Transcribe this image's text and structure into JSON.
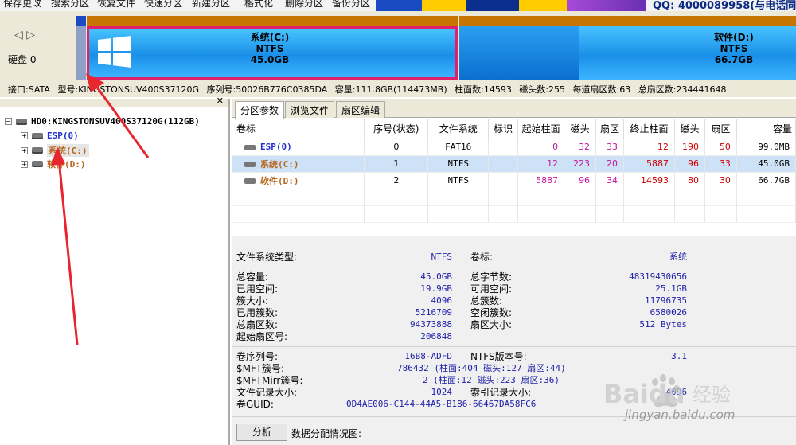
{
  "toolbar": {
    "items": [
      "保存更改",
      "搜索分区",
      "恢复文件",
      "快速分区",
      "新建分区",
      "格式化",
      "删除分区",
      "备份分区"
    ],
    "banner_text": "QQ: 4000089958(与电话同号"
  },
  "disk_strip": {
    "nav_arrows": "◁ ▷",
    "disk_label": "硬盘 0",
    "partitions": [
      {
        "name": "系统(C:)",
        "fs": "NTFS",
        "size": "45.0GB"
      },
      {
        "name": "软件(D:)",
        "fs": "NTFS",
        "size": "66.7GB"
      }
    ]
  },
  "disk_info": {
    "interface": "接口:SATA",
    "model": "型号:KINGSTONSUV400S37120G",
    "serial": "序列号:50026B776C0385DA",
    "capacity": "容量:111.8GB(114473MB)",
    "cylinders": "柱面数:14593",
    "heads": "磁头数:255",
    "sectors_per_track": "每道扇区数:63",
    "total_sectors": "总扇区数:234441648"
  },
  "tree": {
    "disk": "HD0:KINGSTONSUV400S37120G(112GB)",
    "partitions": [
      "ESP(0)",
      "系统(C:)",
      "软件(D:)"
    ]
  },
  "tabs": [
    "分区参数",
    "浏览文件",
    "扇区编辑"
  ],
  "partition_table": {
    "headers": [
      "卷标",
      "序号(状态)",
      "文件系统",
      "标识",
      "起始柱面",
      "磁头",
      "扇区",
      "终止柱面",
      "磁头",
      "扇区",
      "容量"
    ],
    "rows": [
      {
        "label": "ESP(0)",
        "index": "0",
        "fs": "FAT16",
        "flag": "",
        "start_cyl": "0",
        "start_head": "32",
        "start_sec": "33",
        "end_cyl": "12",
        "end_head": "190",
        "end_sec": "50",
        "size": "99.0MB"
      },
      {
        "label": "系统(C:)",
        "index": "1",
        "fs": "NTFS",
        "flag": "",
        "start_cyl": "12",
        "start_head": "223",
        "start_sec": "20",
        "end_cyl": "5887",
        "end_head": "96",
        "end_sec": "33",
        "size": "45.0GB"
      },
      {
        "label": "软件(D:)",
        "index": "2",
        "fs": "NTFS",
        "flag": "",
        "start_cyl": "5887",
        "start_head": "96",
        "start_sec": "34",
        "end_cyl": "14593",
        "end_head": "80",
        "end_sec": "30",
        "size": "66.7GB"
      }
    ]
  },
  "details": {
    "fs_type_label": "文件系统类型:",
    "fs_type": "NTFS",
    "volume_label_label": "卷标:",
    "volume_label": "系统",
    "total_capacity_label": "总容量:",
    "total_capacity": "45.0GB",
    "total_bytes_label": "总字节数:",
    "total_bytes": "48319430656",
    "used_space_label": "已用空间:",
    "used_space": "19.9GB",
    "free_space_label": "可用空间:",
    "free_space": "25.1GB",
    "cluster_size_label": "簇大小:",
    "cluster_size": "4096",
    "total_clusters_label": "总簇数:",
    "total_clusters": "11796735",
    "used_clusters_label": "已用簇数:",
    "used_clusters": "5216709",
    "free_clusters_label": "空闲簇数:",
    "free_clusters": "6580026",
    "total_sectors_label": "总扇区数:",
    "total_sectors": "94373888",
    "sector_size_label": "扇区大小:",
    "sector_size": "512 Bytes",
    "start_sector_label": "起始扇区号:",
    "start_sector": "206848",
    "volume_serial_label": "卷序列号:",
    "volume_serial": "16B8-ADFD",
    "ntfs_version_label": "NTFS版本号:",
    "ntfs_version": "3.1",
    "mft_cluster_label": "$MFT簇号:",
    "mft_cluster": "786432 (柱面:404 磁头:127 扇区:44)",
    "mftmirr_cluster_label": "$MFTMirr簇号:",
    "mftmirr_cluster": "2 (柱面:12 磁头:223 扇区:36)",
    "file_record_size_label": "文件记录大小:",
    "file_record_size": "1024",
    "index_record_size_label": "索引记录大小:",
    "index_record_size": "4096",
    "volume_guid_label": "卷GUID:",
    "volume_guid": "0D4AE006-C144-44A5-B186-66467DA58FC6"
  },
  "analyze_button": "分析",
  "data_distribution_label": "数据分配情况图:",
  "watermark": {
    "brand": "Baidu",
    "brand_cn": "经验",
    "url": "jingyan.baidu.com"
  },
  "colors": {
    "partition_bar_orange": "#c77400",
    "partition_fill_blue": "#1a8fe8",
    "selected_row": "#cde2f7",
    "highlight_border": "#e0206c",
    "annotation_red": "#e8262e"
  }
}
